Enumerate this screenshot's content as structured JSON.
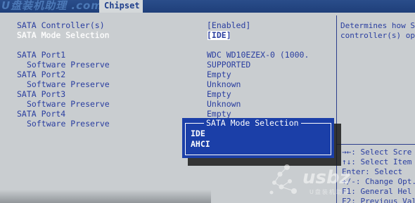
{
  "header": {
    "logo_text": "U盘装机助理 .com",
    "active_tab": "Chipset"
  },
  "settings": [
    {
      "label": "SATA Controller(s)",
      "value": "[Enabled]",
      "sub": false,
      "highlight": false
    },
    {
      "label": "SATA Mode Selection",
      "value": "[IDE]",
      "sub": false,
      "highlight": true
    },
    {
      "label": "SATA Port1",
      "value": "WDC WD10EZEX-0 (1000.",
      "sub": false,
      "highlight": false
    },
    {
      "label": "Software Preserve",
      "value": "SUPPORTED",
      "sub": true,
      "highlight": false
    },
    {
      "label": "SATA Port2",
      "value": "Empty",
      "sub": false,
      "highlight": false
    },
    {
      "label": "Software Preserve",
      "value": "Unknown",
      "sub": true,
      "highlight": false
    },
    {
      "label": "SATA Port3",
      "value": "Empty",
      "sub": false,
      "highlight": false
    },
    {
      "label": "Software Preserve",
      "value": "Unknown",
      "sub": true,
      "highlight": false
    },
    {
      "label": "SATA Port4",
      "value": "Empty",
      "sub": false,
      "highlight": false
    },
    {
      "label": "Software Preserve",
      "value": "",
      "sub": true,
      "highlight": false
    }
  ],
  "help": {
    "line1": "Determines how S",
    "line2": "controller(s) op",
    "keys": [
      "→←: Select Scre",
      "↑↓: Select Item",
      "Enter: Select",
      "+/-: Change Opt.",
      "F1: General Hel",
      "F2: Previous Val"
    ]
  },
  "popup": {
    "title": "SATA Mode Selection",
    "options": [
      "IDE",
      "AHCI"
    ]
  },
  "watermark": {
    "text": "usbz",
    "sub": "U盘装机助理"
  },
  "colors": {
    "background": "#c9cdd0",
    "text_blue": "#2a3ea0",
    "popup_bg": "#1b3fa8",
    "topbar": "#1f3f7a"
  }
}
